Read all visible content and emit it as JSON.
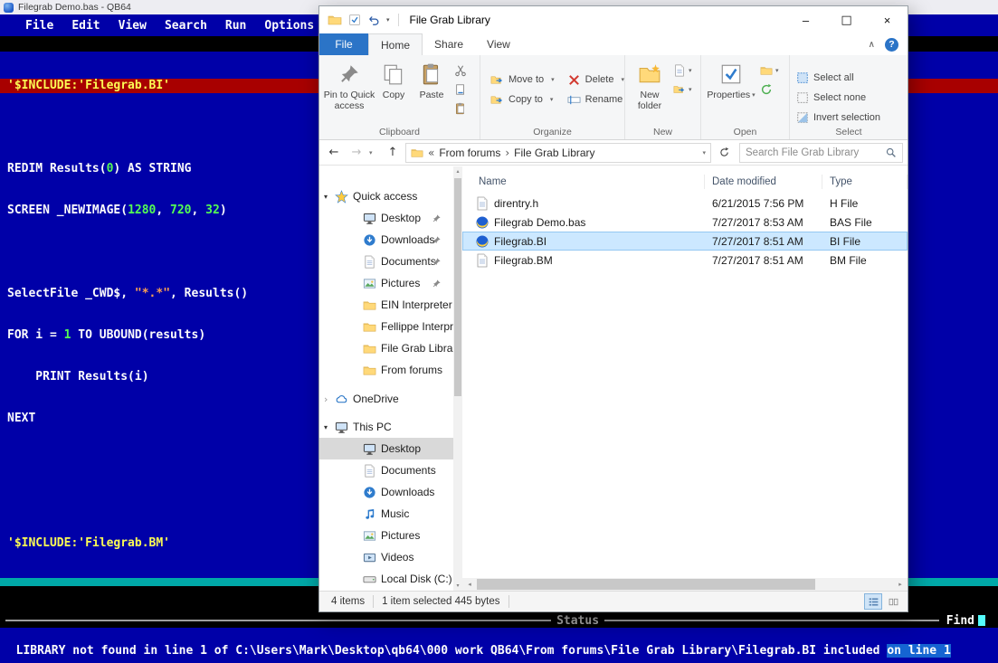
{
  "qb64": {
    "window_title": "Filegrab Demo.bas - QB64",
    "menu": [
      "File",
      "Edit",
      "View",
      "Search",
      "Run",
      "Options"
    ],
    "code": {
      "include_bi": "'$INCLUDE:'Filegrab.BI'",
      "redim_a": "REDIM Results(",
      "redim_n": "0",
      "redim_b": ") AS STRING",
      "screen_a": "SCREEN _NEWIMAGE(",
      "screen_n1": "1280",
      "sep1": ", ",
      "screen_n2": "720",
      "sep2": ", ",
      "screen_n3": "32",
      "screen_b": ")",
      "select_a": "SelectFile _CWD$, ",
      "select_s": "\"*.*\"",
      "select_b": ", Results()",
      "for_a": "FOR i = ",
      "for_n": "1",
      "for_b": " TO UBOUND(results)",
      "print_line": "    PRINT Results(i)",
      "next_line": "NEXT",
      "include_bm": "'$INCLUDE:'Filegrab.BM'"
    },
    "status_separator_label": "Status",
    "find_label": "Find",
    "error_message": "LIBRARY not found in line 1 of C:\\Users\\Mark\\Desktop\\qb64\\000 work QB64\\From forums\\File Grab Library\\Filegrab.BI included ",
    "error_highlight": "on line 1"
  },
  "explorer": {
    "title": "File Grab Library",
    "window_controls": {
      "minimize": "–",
      "maximize": "□",
      "close": "×"
    },
    "tabs": {
      "file": "File",
      "home": "Home",
      "share": "Share",
      "view": "View"
    },
    "ribbon": {
      "clipboard": {
        "group": "Clipboard",
        "pin": "Pin to Quick access",
        "copy": "Copy",
        "paste": "Paste"
      },
      "organize": {
        "group": "Organize",
        "move_to": "Move to",
        "copy_to": "Copy to",
        "delete": "Delete",
        "rename": "Rename"
      },
      "new": {
        "group": "New",
        "new_folder": "New folder"
      },
      "open": {
        "group": "Open",
        "properties": "Properties"
      },
      "select": {
        "group": "Select",
        "select_all": "Select all",
        "select_none": "Select none",
        "invert": "Invert selection"
      }
    },
    "address": {
      "crumb_root": "From forums",
      "crumb_current": "File Grab Library",
      "search_placeholder": "Search File Grab Library"
    },
    "nav": {
      "quick_access": "Quick access",
      "quick_items": [
        {
          "label": "Desktop"
        },
        {
          "label": "Downloads"
        },
        {
          "label": "Documents"
        },
        {
          "label": "Pictures"
        },
        {
          "label": "EIN Interpreter"
        },
        {
          "label": "Fellippe Interpre"
        },
        {
          "label": "File Grab Library"
        },
        {
          "label": "From forums"
        }
      ],
      "onedrive": "OneDrive",
      "this_pc": "This PC",
      "pc_items": [
        {
          "label": "Desktop"
        },
        {
          "label": "Documents"
        },
        {
          "label": "Downloads"
        },
        {
          "label": "Music"
        },
        {
          "label": "Pictures"
        },
        {
          "label": "Videos"
        },
        {
          "label": "Local Disk (C:)"
        }
      ]
    },
    "files": {
      "columns": {
        "name": "Name",
        "date": "Date modified",
        "type": "Type"
      },
      "rows": [
        {
          "name": "direntry.h",
          "date": "6/21/2015 7:56 PM",
          "type": "H File"
        },
        {
          "name": "Filegrab Demo.bas",
          "date": "7/27/2017 8:53 AM",
          "type": "BAS File"
        },
        {
          "name": "Filegrab.BI",
          "date": "7/27/2017 8:51 AM",
          "type": "BI File"
        },
        {
          "name": "Filegrab.BM",
          "date": "7/27/2017 8:51 AM",
          "type": "BM File"
        }
      ]
    },
    "status": {
      "items": "4 items",
      "selection": "1 item selected 445 bytes"
    }
  },
  "colors": {
    "qb64_background": "#0000A8",
    "qb64_error_band": "#A80000",
    "qb64_metacommand": "#FCFC54",
    "qb64_cursor_line": "#00A8A8",
    "qb64_number": "#54FC54",
    "qb64_string": "#FCA054",
    "error_highlight_bg": "#1565D2",
    "file_tab_blue": "#2B74C7",
    "selection_fill": "#CCE8FF",
    "selection_border": "#94C8F2"
  }
}
